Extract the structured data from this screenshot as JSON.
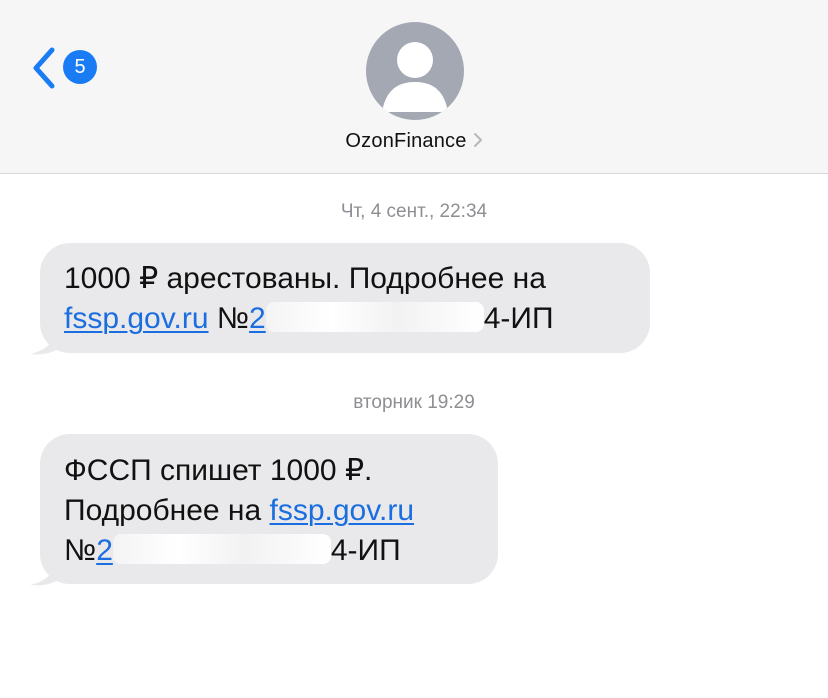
{
  "header": {
    "back_badge": "5",
    "contact_name": "OzonFinance"
  },
  "messages": [
    {
      "timestamp": "Чт, 4 сент., 22:34",
      "line1": "1000 ₽ арестованы. Подробнее на",
      "link": "fssp.gov.ru",
      "case_prefix": "№",
      "case_start": "2",
      "case_end": "4-ИП"
    },
    {
      "timestamp": "вторник 19:29",
      "line1": "ФССП спишет 1000 ₽.",
      "line2_text": "Подробнее на ",
      "link": "fssp.gov.ru",
      "case_prefix": "№",
      "case_start": "2",
      "case_end": "4-ИП"
    }
  ],
  "colors": {
    "accent": "#1a7cf5",
    "bubble": "#e9e9eb",
    "link": "#1a6ee0",
    "timestamp": "#8e8e93"
  },
  "icons": [
    "back-chevron-icon",
    "person-icon",
    "chevron-right-icon"
  ]
}
